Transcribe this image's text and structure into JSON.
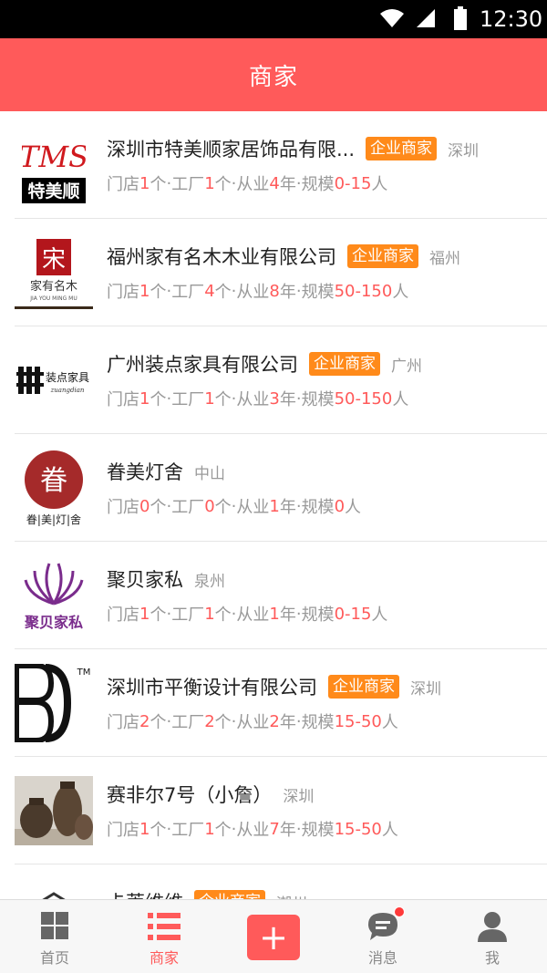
{
  "status_bar": {
    "time": "12:30"
  },
  "header": {
    "title": "商家"
  },
  "labels": {
    "stores": "门店",
    "factories": "工厂",
    "years": "从业",
    "scale": "规模",
    "unit_count": "个",
    "unit_year": "年",
    "unit_person": "人",
    "sep": " · "
  },
  "merchants": [
    {
      "logo": "tms-logo",
      "logo_text": "特美顺",
      "name": "深圳市特美顺家居饰品有限...",
      "badge": "企业商家",
      "city": "深圳",
      "stores": "1",
      "factories": "1",
      "years": "4",
      "scale": "0-15"
    },
    {
      "logo": "jiayou-logo",
      "logo_text": "家有名木",
      "logo_sub": "JIA YOU MING MU",
      "name": "福州家有名木木业有限公司",
      "badge": "企业商家",
      "city": "福州",
      "stores": "1",
      "factories": "4",
      "years": "8",
      "scale": "50-150"
    },
    {
      "logo": "zhuangdian-logo",
      "logo_text": "装点家具",
      "name": "广州装点家具有限公司",
      "badge": "企业商家",
      "city": "广州",
      "stores": "1",
      "factories": "1",
      "years": "3",
      "scale": "50-150"
    },
    {
      "logo": "juanmei-logo",
      "logo_text": "眷|美|灯|舍",
      "name": "眷美灯舍",
      "badge": "",
      "city": "中山",
      "stores": "0",
      "factories": "0",
      "years": "1",
      "scale": "0"
    },
    {
      "logo": "jubei-logo",
      "logo_text": "聚贝家私",
      "name": "聚贝家私",
      "badge": "",
      "city": "泉州",
      "stores": "1",
      "factories": "1",
      "years": "1",
      "scale": "0-15"
    },
    {
      "logo": "bd-logo",
      "logo_text": "TM",
      "name": "深圳市平衡设计有限公司",
      "badge": "企业商家",
      "city": "深圳",
      "stores": "2",
      "factories": "2",
      "years": "2",
      "scale": "15-50"
    },
    {
      "logo": "pottery-photo",
      "name": "赛非尔7号（小詹）",
      "badge": "",
      "city": "深圳",
      "stores": "1",
      "factories": "1",
      "years": "7",
      "scale": "15-50"
    },
    {
      "logo": "house-logo",
      "name": "卡莱维维",
      "badge": "企业商家",
      "city": "潮州"
    }
  ],
  "bottom_nav": {
    "items": [
      {
        "label": "首页",
        "icon": "grid-icon"
      },
      {
        "label": "商家",
        "icon": "list-icon"
      },
      {
        "label": "",
        "icon": "plus-icon"
      },
      {
        "label": "消息",
        "icon": "chat-icon"
      },
      {
        "label": "我",
        "icon": "person-icon"
      }
    ],
    "active_color": "#ff5a5a",
    "inactive_color": "#888888"
  },
  "colors": {
    "brand": "#ff5a5a",
    "badge": "#ff8a1a"
  }
}
